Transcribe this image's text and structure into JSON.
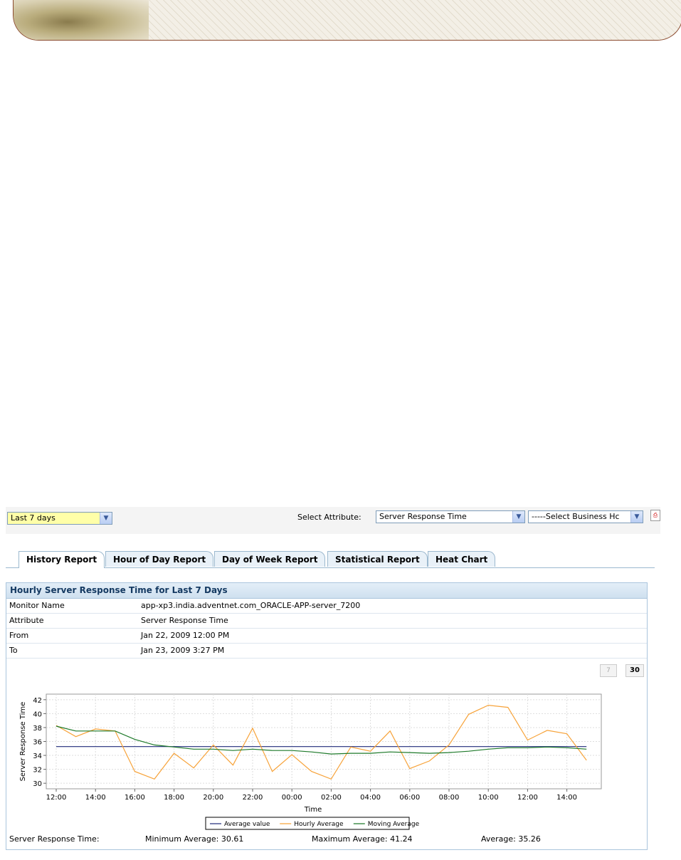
{
  "period_select": {
    "value": "Last 7 days"
  },
  "attribute": {
    "label": "Select Attribute:",
    "value": "Server Response Time"
  },
  "business_hours": {
    "value": "-----Select Business Hc"
  },
  "tabs": [
    {
      "label": "History Report"
    },
    {
      "label": "Hour of Day Report"
    },
    {
      "label": "Day of Week Report"
    },
    {
      "label": "Statistical Report"
    },
    {
      "label": "Heat Chart"
    }
  ],
  "panel": {
    "title": "Hourly Server Response Time for Last 7 Days",
    "rows": [
      {
        "key": "Monitor Name",
        "value": "app-xp3.india.adventnet.com_ORACLE-APP-server_7200"
      },
      {
        "key": "Attribute",
        "value": "Server Response Time"
      },
      {
        "key": "From",
        "value": "Jan 22, 2009 12:00 PM"
      },
      {
        "key": "To",
        "value": "Jan 23, 2009 3:27 PM"
      }
    ],
    "btn7": "7",
    "btn30": "30"
  },
  "stats": {
    "label": "Server Response Time:",
    "min": "Minimum Average:  30.61",
    "max": "Maximum Average:  41.24",
    "avg": "Average:  35.26"
  },
  "colors": {
    "avg": "#1f2a7a",
    "hourly": "#f7a33a",
    "moving": "#1e7a2a"
  },
  "chart_data": {
    "type": "line",
    "xlabel": "Time",
    "ylabel": "Server Response Time",
    "ylim": [
      29.2,
      42.8
    ],
    "yticks": [
      30,
      32,
      34,
      36,
      38,
      40,
      42
    ],
    "xtick_labels": [
      "12:00",
      "14:00",
      "16:00",
      "18:00",
      "20:00",
      "22:00",
      "00:00",
      "02:00",
      "04:00",
      "06:00",
      "08:00",
      "10:00",
      "12:00",
      "14:00"
    ],
    "x_hours": [
      0,
      1,
      2,
      3,
      4,
      5,
      6,
      7,
      8,
      9,
      10,
      11,
      12,
      13,
      14,
      15,
      16,
      17,
      18,
      19,
      20,
      21,
      22,
      23,
      24,
      25,
      26,
      27
    ],
    "series": [
      {
        "name": "Average value",
        "values": [
          35.26,
          35.26,
          35.26,
          35.26,
          35.26,
          35.26,
          35.26,
          35.26,
          35.26,
          35.26,
          35.26,
          35.26,
          35.26,
          35.26,
          35.26,
          35.26,
          35.26,
          35.26,
          35.26,
          35.26,
          35.26,
          35.26,
          35.26,
          35.26,
          35.26,
          35.26,
          35.26,
          35.26
        ]
      },
      {
        "name": "Hourly Average",
        "values": [
          38.3,
          36.7,
          37.8,
          37.5,
          31.7,
          30.6,
          34.3,
          32.2,
          35.5,
          32.6,
          37.9,
          31.7,
          34.1,
          31.7,
          30.6,
          35.2,
          34.6,
          37.5,
          32.1,
          33.2,
          35.5,
          39.9,
          41.2,
          40.9,
          36.2,
          37.6,
          37.1,
          33.3
        ]
      },
      {
        "name": "Moving Average",
        "values": [
          38.2,
          37.5,
          37.5,
          37.5,
          36.3,
          35.5,
          35.2,
          34.9,
          34.9,
          34.7,
          34.9,
          34.7,
          34.7,
          34.5,
          34.2,
          34.3,
          34.3,
          34.5,
          34.4,
          34.3,
          34.4,
          34.6,
          34.9,
          35.1,
          35.1,
          35.2,
          35.1,
          34.9
        ]
      }
    ],
    "legend": "bottom"
  }
}
